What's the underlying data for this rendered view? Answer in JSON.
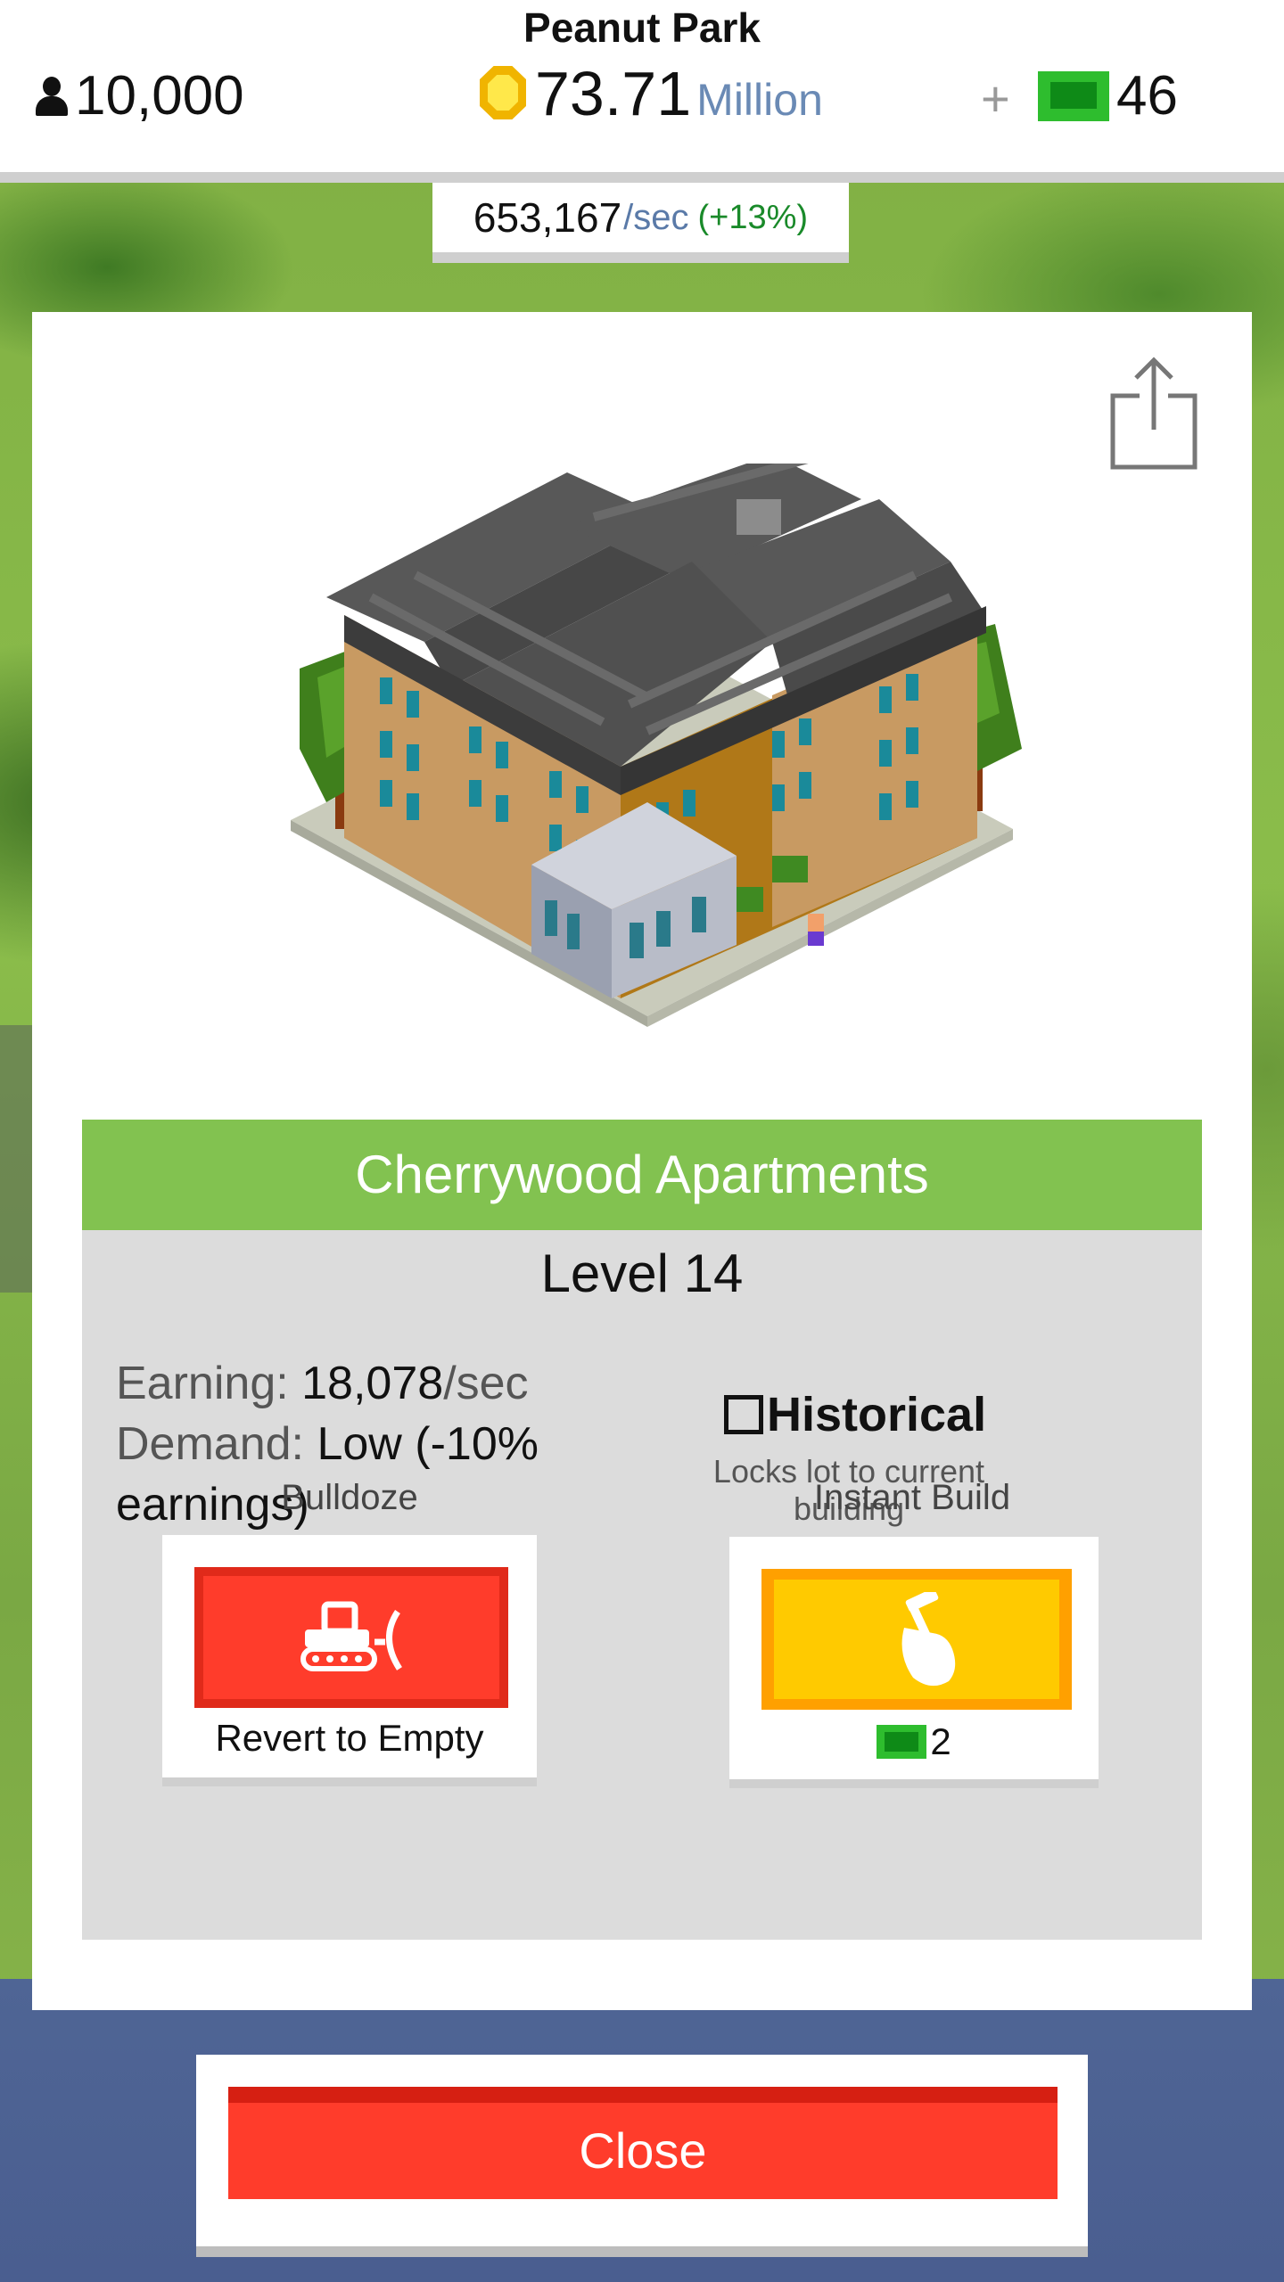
{
  "header": {
    "park_name": "Peanut Park",
    "population": "10,000",
    "money_value": "73.71",
    "money_unit": "Million",
    "plus": "+",
    "gems": "46",
    "rate_value": "653,167",
    "rate_unit": "/sec",
    "rate_bonus": "(+13%)"
  },
  "building": {
    "name": "Cherrywood Apartments",
    "level": "Level 14",
    "earning_label": "Earning:",
    "earning_value": "18,078",
    "earning_unit": "/sec",
    "demand_label": "Demand:",
    "demand_value": "Low (-10% earnings)",
    "historical_label": "Historical",
    "historical_checked": false,
    "historical_sub": "Locks lot to current building"
  },
  "actions": {
    "bulldoze_label": "Bulldoze",
    "bulldoze_caption": "Revert to Empty",
    "instant_build_label": "Instant Build",
    "instant_build_cost": "2"
  },
  "close_label": "Close",
  "icons": {
    "population": "person-icon",
    "money": "coin-icon",
    "gems": "bill-icon",
    "share": "share-icon",
    "bulldoze": "bulldozer-icon",
    "instant_build": "hammer-hand-icon"
  },
  "colors": {
    "title_bar": "#82c250",
    "bulldoze": "#ff3c2b",
    "instant_build": "#ffca00",
    "close": "#ff3c2b",
    "gem_green": "#2ebd2e"
  }
}
